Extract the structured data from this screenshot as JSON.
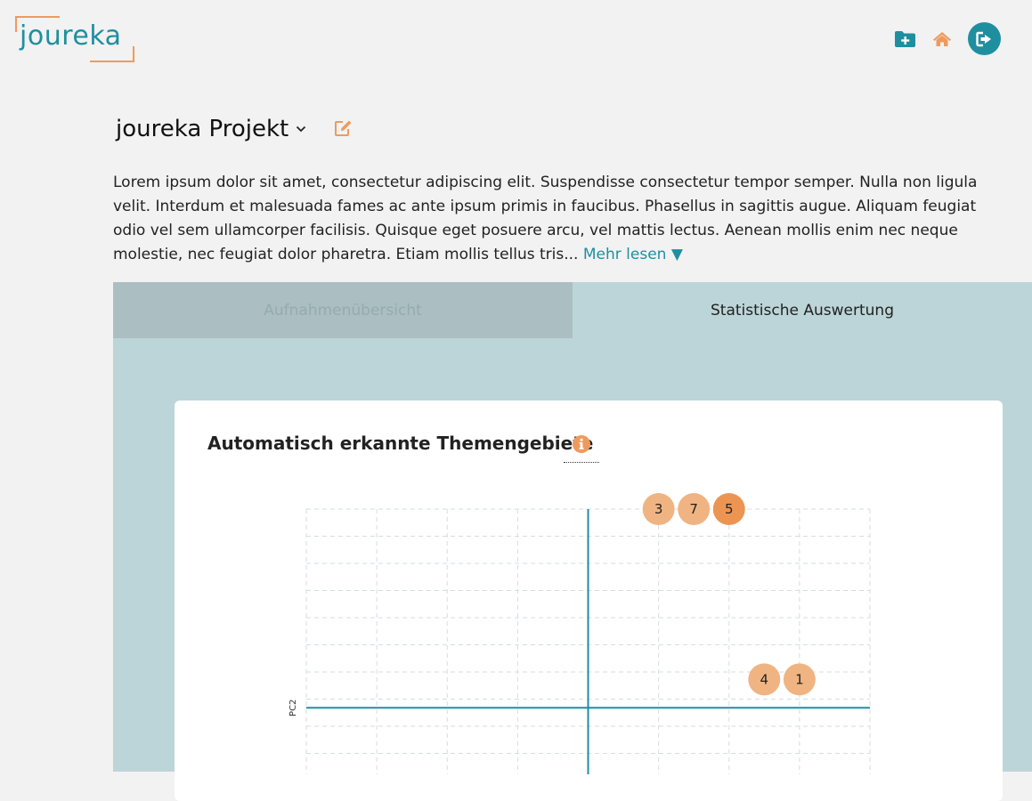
{
  "brand": {
    "logo_text": "joureka",
    "primary": "#1f8fa0",
    "accent": "#ef9a5d"
  },
  "header": {
    "icons": [
      "folder-plus-icon",
      "home-icon",
      "logout-icon"
    ]
  },
  "project": {
    "title": "joureka Projekt",
    "description": "Lorem ipsum dolor sit amet, consectetur adipiscing elit. Suspendisse consectetur tempor semper. Nulla non ligula velit. Interdum et malesuada fames ac ante ipsum primis in faucibus. Phasellus in sagittis augue. Aliquam feugiat odio vel sem ullamcorper facilisis. Quisque eget posuere arcu, vel mattis lectus. Aenean mollis enim nec neque molestie, nec feugiat dolor pharetra. Etiam mollis tellus tris...",
    "more_label": "Mehr lesen ▼"
  },
  "tabs": [
    {
      "label": "Aufnahmenübersicht",
      "active": false
    },
    {
      "label": "Statistische Auswertung",
      "active": true
    }
  ],
  "topics": {
    "title": "Automatisch erkannte Themengebiete"
  },
  "chart_data": {
    "type": "scatter",
    "ylabel": "PC2",
    "xlabel": "",
    "xlim": [
      -4,
      4
    ],
    "ylim": [
      -2.5,
      7
    ],
    "grid": true,
    "points": [
      {
        "label": "3",
        "x": 1.0,
        "y": 7.0,
        "highlight": false
      },
      {
        "label": "7",
        "x": 1.5,
        "y": 7.0,
        "highlight": false
      },
      {
        "label": "5",
        "x": 2.0,
        "y": 7.0,
        "highlight": true
      },
      {
        "label": "4",
        "x": 2.5,
        "y": 1.0,
        "highlight": false
      },
      {
        "label": "1",
        "x": 3.0,
        "y": 1.0,
        "highlight": false
      }
    ],
    "colors": {
      "point": "#f0b482",
      "point_highlight": "#ec9552",
      "axis": "#1f8fa0",
      "grid": "#d6dde0"
    }
  }
}
